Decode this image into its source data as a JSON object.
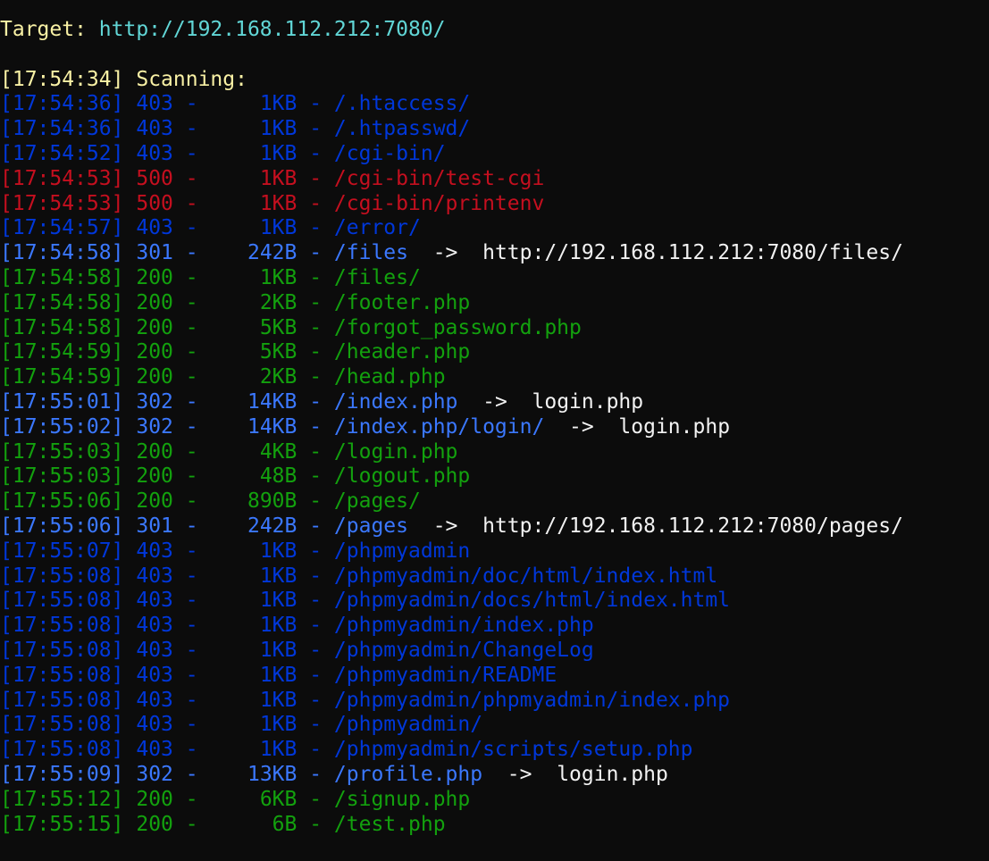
{
  "header": {
    "target_label": "Target:",
    "target_url": "http://192.168.112.212:7080/"
  },
  "scanning": {
    "time": "[17:54:34]",
    "label": "Scanning:"
  },
  "colors": {
    "403": "#0037da",
    "500": "#c50f1f",
    "200": "#13a10e",
    "3xx": "#3b78ff",
    "yellow": "#f9f1a5",
    "cyan": "#61d6d6",
    "white": "#f2f2f2",
    "background": "#0c0c0c"
  },
  "results": [
    {
      "time": "[17:54:36]",
      "status": "403",
      "size": "1KB",
      "path": "/.htaccess/",
      "redirect": ""
    },
    {
      "time": "[17:54:36]",
      "status": "403",
      "size": "1KB",
      "path": "/.htpasswd/",
      "redirect": ""
    },
    {
      "time": "[17:54:52]",
      "status": "403",
      "size": "1KB",
      "path": "/cgi-bin/",
      "redirect": ""
    },
    {
      "time": "[17:54:53]",
      "status": "500",
      "size": "1KB",
      "path": "/cgi-bin/test-cgi",
      "redirect": ""
    },
    {
      "time": "[17:54:53]",
      "status": "500",
      "size": "1KB",
      "path": "/cgi-bin/printenv",
      "redirect": ""
    },
    {
      "time": "[17:54:57]",
      "status": "403",
      "size": "1KB",
      "path": "/error/",
      "redirect": ""
    },
    {
      "time": "[17:54:58]",
      "status": "301",
      "size": "242B",
      "path": "/files",
      "redirect": "http://192.168.112.212:7080/files/"
    },
    {
      "time": "[17:54:58]",
      "status": "200",
      "size": "1KB",
      "path": "/files/",
      "redirect": ""
    },
    {
      "time": "[17:54:58]",
      "status": "200",
      "size": "2KB",
      "path": "/footer.php",
      "redirect": ""
    },
    {
      "time": "[17:54:58]",
      "status": "200",
      "size": "5KB",
      "path": "/forgot_password.php",
      "redirect": ""
    },
    {
      "time": "[17:54:59]",
      "status": "200",
      "size": "5KB",
      "path": "/header.php",
      "redirect": ""
    },
    {
      "time": "[17:54:59]",
      "status": "200",
      "size": "2KB",
      "path": "/head.php",
      "redirect": ""
    },
    {
      "time": "[17:55:01]",
      "status": "302",
      "size": "14KB",
      "path": "/index.php",
      "redirect": "login.php"
    },
    {
      "time": "[17:55:02]",
      "status": "302",
      "size": "14KB",
      "path": "/index.php/login/",
      "redirect": "login.php"
    },
    {
      "time": "[17:55:03]",
      "status": "200",
      "size": "4KB",
      "path": "/login.php",
      "redirect": ""
    },
    {
      "time": "[17:55:03]",
      "status": "200",
      "size": "48B",
      "path": "/logout.php",
      "redirect": ""
    },
    {
      "time": "[17:55:06]",
      "status": "200",
      "size": "890B",
      "path": "/pages/",
      "redirect": ""
    },
    {
      "time": "[17:55:06]",
      "status": "301",
      "size": "242B",
      "path": "/pages",
      "redirect": "http://192.168.112.212:7080/pages/"
    },
    {
      "time": "[17:55:07]",
      "status": "403",
      "size": "1KB",
      "path": "/phpmyadmin",
      "redirect": ""
    },
    {
      "time": "[17:55:08]",
      "status": "403",
      "size": "1KB",
      "path": "/phpmyadmin/doc/html/index.html",
      "redirect": ""
    },
    {
      "time": "[17:55:08]",
      "status": "403",
      "size": "1KB",
      "path": "/phpmyadmin/docs/html/index.html",
      "redirect": ""
    },
    {
      "time": "[17:55:08]",
      "status": "403",
      "size": "1KB",
      "path": "/phpmyadmin/index.php",
      "redirect": ""
    },
    {
      "time": "[17:55:08]",
      "status": "403",
      "size": "1KB",
      "path": "/phpmyadmin/ChangeLog",
      "redirect": ""
    },
    {
      "time": "[17:55:08]",
      "status": "403",
      "size": "1KB",
      "path": "/phpmyadmin/README",
      "redirect": ""
    },
    {
      "time": "[17:55:08]",
      "status": "403",
      "size": "1KB",
      "path": "/phpmyadmin/phpmyadmin/index.php",
      "redirect": ""
    },
    {
      "time": "[17:55:08]",
      "status": "403",
      "size": "1KB",
      "path": "/phpmyadmin/",
      "redirect": ""
    },
    {
      "time": "[17:55:08]",
      "status": "403",
      "size": "1KB",
      "path": "/phpmyadmin/scripts/setup.php",
      "redirect": ""
    },
    {
      "time": "[17:55:09]",
      "status": "302",
      "size": "13KB",
      "path": "/profile.php",
      "redirect": "login.php"
    },
    {
      "time": "[17:55:12]",
      "status": "200",
      "size": "6KB",
      "path": "/signup.php",
      "redirect": ""
    },
    {
      "time": "[17:55:15]",
      "status": "200",
      "size": "6B",
      "path": "/test.php",
      "redirect": ""
    }
  ]
}
